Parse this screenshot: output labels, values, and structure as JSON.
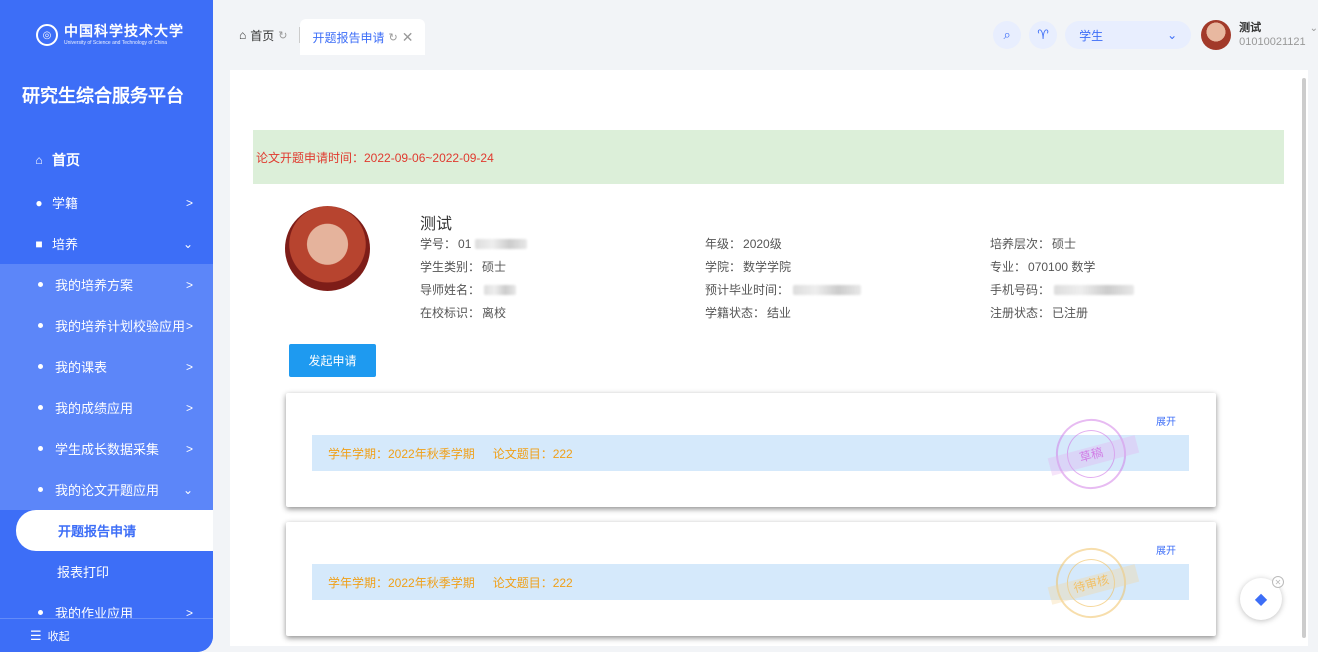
{
  "logo": {
    "cn": "中国科学技术大学",
    "en": "University of Science and Technology of China"
  },
  "sidebar": {
    "platform_title": "研究生综合服务平台",
    "home": "首页",
    "items": [
      {
        "label": "学籍",
        "icon": "user-icon"
      },
      {
        "label": "培养",
        "icon": "book-icon"
      }
    ],
    "sub_items": [
      "我的培养方案",
      "我的培养计划校验应用",
      "我的课表",
      "我的成绩应用",
      "学生成长数据采集",
      "我的论文开题应用"
    ],
    "leaf_items": [
      "开题报告申请",
      "报表打印"
    ],
    "extra_item": "我的作业应用",
    "collapse": "收起"
  },
  "tabs": [
    {
      "label": "首页",
      "icon": "home-icon"
    },
    {
      "label": "开题报告申请",
      "active": true
    }
  ],
  "header": {
    "role": "学生",
    "user_name": "测试",
    "user_id": "01010021121"
  },
  "notice": "论文开题申请时间：2022-09-06~2022-09-24",
  "profile": {
    "name": "测试",
    "fields": [
      {
        "label": "学号：",
        "value": "01"
      },
      {
        "label": "年级：",
        "value": "2020级"
      },
      {
        "label": "培养层次：",
        "value": "硕士"
      },
      {
        "label": "学生类别：",
        "value": "硕士"
      },
      {
        "label": "学院：",
        "value": "数学学院"
      },
      {
        "label": "专业：",
        "value": "070100 数学"
      },
      {
        "label": "导师姓名：",
        "value": ""
      },
      {
        "label": "预计毕业时间：",
        "value": ""
      },
      {
        "label": "手机号码：",
        "value": ""
      },
      {
        "label": "在校标识：",
        "value": "离校"
      },
      {
        "label": "学籍状态：",
        "value": "结业"
      },
      {
        "label": "注册状态：",
        "value": "已注册"
      }
    ]
  },
  "apply_button": "发起申请",
  "cards": [
    {
      "expand": "展开",
      "term": "学年学期：2022年秋季学期",
      "topic": "论文题目：222",
      "stamp": "草稿"
    },
    {
      "expand": "展开",
      "term": "学年学期：2022年秋季学期",
      "topic": "论文题目：222",
      "stamp": "待审核"
    }
  ],
  "colors": {
    "primary": "#3d6ef7",
    "notice_bg": "#dcefd9",
    "notice_text": "#e03a2f",
    "card_text": "#f0a018"
  }
}
